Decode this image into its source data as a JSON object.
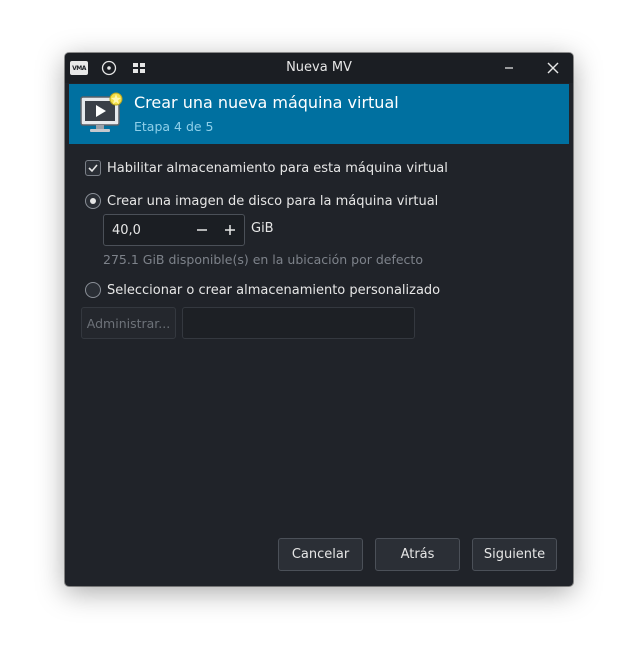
{
  "window": {
    "title": "Nueva MV"
  },
  "titlebar": {
    "logo_text": "VMA",
    "icons": [
      "app-logo-icon",
      "pin-icon",
      "grid-menu-icon",
      "minimize-icon",
      "close-icon"
    ]
  },
  "banner": {
    "heading": "Crear una nueva máquina virtual",
    "step": "Etapa 4 de 5",
    "color": "#0070a0"
  },
  "storage": {
    "enable_label": "Habilitar almacenamiento para esta máquina virtual",
    "enable_checked": true,
    "create_image_label": "Crear una imagen de disco para la máquina virtual",
    "create_image_selected": true,
    "size_value": "40,0",
    "size_unit": "GiB",
    "available_text": "275.1 GiB disponible(s) en la ubicación por defecto",
    "custom_label": "Seleccionar o crear almacenamiento personalizado",
    "custom_selected": false,
    "manage_label": "Administrar...",
    "path_value": ""
  },
  "footer": {
    "cancel_label": "Cancelar",
    "back_label": "Atrás",
    "next_label": "Siguiente"
  }
}
